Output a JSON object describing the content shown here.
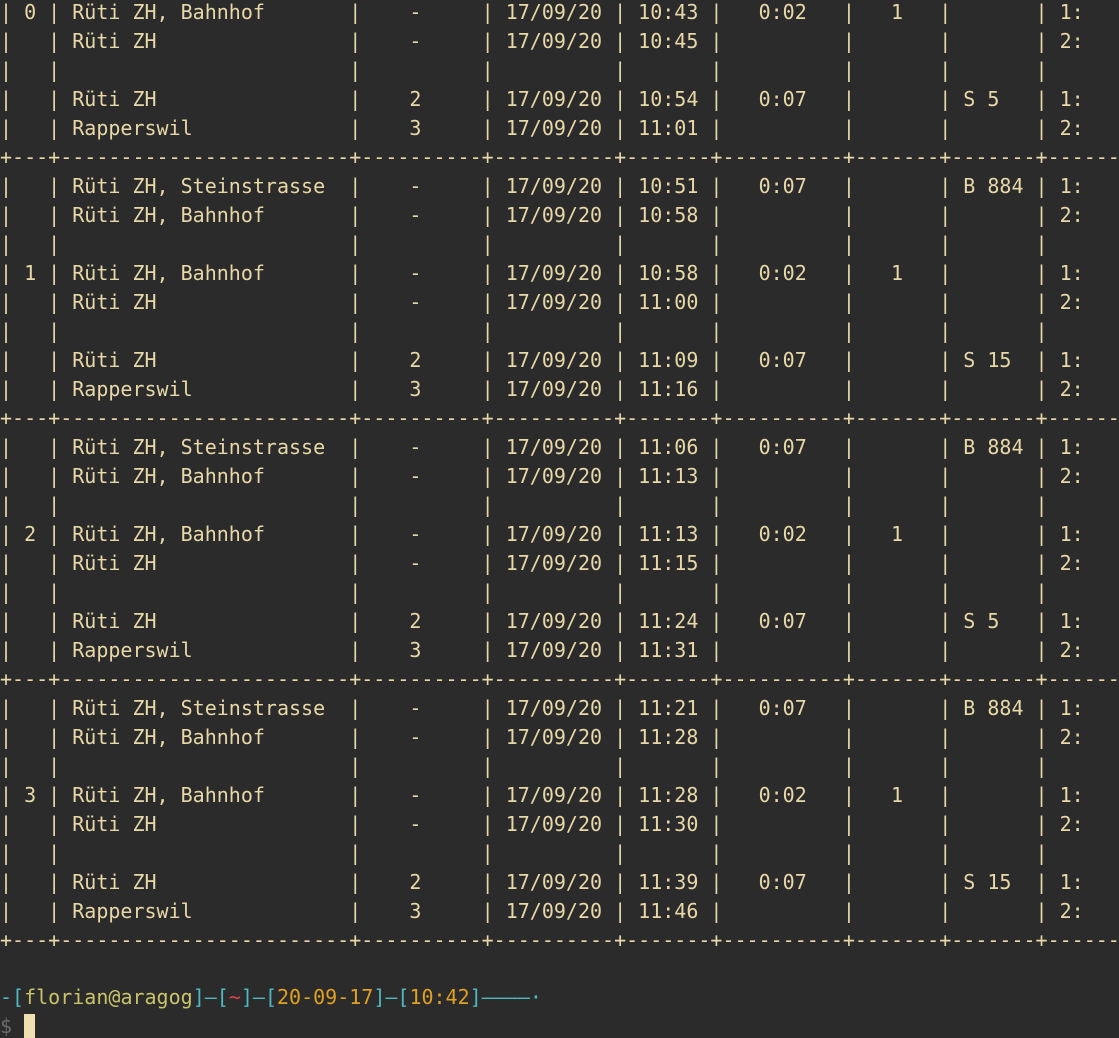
{
  "terminal": {
    "table_lines": [
      "| 0 | Rüti ZH, Bahnhof       |    -     | 17/09/20 | 10:43 |   0:02   |   1   |       | 1:         |",
      "|   | Rüti ZH                |    -     | 17/09/20 | 10:45 |          |       |       | 2:         |",
      "|   |                        |          |          |       |          |       |       |            |",
      "|   | Rüti ZH                |    2     | 17/09/20 | 10:54 |   0:07   |       | S 5   | 1:         |",
      "|   | Rapperswil             |    3     | 17/09/20 | 11:01 |          |       |       | 2:         |",
      "+---+------------------------+----------+----------+-------+----------+-------+-------+------------+",
      "|   | Rüti ZH, Steinstrasse  |    -     | 17/09/20 | 10:51 |   0:07   |       | B 884 | 1:         |",
      "|   | Rüti ZH, Bahnhof       |    -     | 17/09/20 | 10:58 |          |       |       | 2:         |",
      "|   |                        |          |          |       |          |       |       |            |",
      "| 1 | Rüti ZH, Bahnhof       |    -     | 17/09/20 | 10:58 |   0:02   |   1   |       | 1:         |",
      "|   | Rüti ZH                |    -     | 17/09/20 | 11:00 |          |       |       | 2:         |",
      "|   |                        |          |          |       |          |       |       |            |",
      "|   | Rüti ZH                |    2     | 17/09/20 | 11:09 |   0:07   |       | S 15  | 1:         |",
      "|   | Rapperswil             |    3     | 17/09/20 | 11:16 |          |       |       | 2:         |",
      "+---+------------------------+----------+----------+-------+----------+-------+-------+------------+",
      "|   | Rüti ZH, Steinstrasse  |    -     | 17/09/20 | 11:06 |   0:07   |       | B 884 | 1:         |",
      "|   | Rüti ZH, Bahnhof       |    -     | 17/09/20 | 11:13 |          |       |       | 2:         |",
      "|   |                        |          |          |       |          |       |       |            |",
      "| 2 | Rüti ZH, Bahnhof       |    -     | 17/09/20 | 11:13 |   0:02   |   1   |       | 1:         |",
      "|   | Rüti ZH                |    -     | 17/09/20 | 11:15 |          |       |       | 2:         |",
      "|   |                        |          |          |       |          |       |       |            |",
      "|   | Rüti ZH                |    2     | 17/09/20 | 11:24 |   0:07   |       | S 5   | 1:         |",
      "|   | Rapperswil             |    3     | 17/09/20 | 11:31 |          |       |       | 2:         |",
      "+---+------------------------+----------+----------+-------+----------+-------+-------+------------+",
      "|   | Rüti ZH, Steinstrasse  |    -     | 17/09/20 | 11:21 |   0:07   |       | B 884 | 1:         |",
      "|   | Rüti ZH, Bahnhof       |    -     | 17/09/20 | 11:28 |          |       |       | 2:         |",
      "|   |                        |          |          |       |          |       |       |            |",
      "| 3 | Rüti ZH, Bahnhof       |    -     | 17/09/20 | 11:28 |   0:02   |   1   |       | 1:         |",
      "|   | Rüti ZH                |    -     | 17/09/20 | 11:30 |          |       |       | 2:         |",
      "|   |                        |          |          |       |          |       |       |            |",
      "|   | Rüti ZH                |    2     | 17/09/20 | 11:39 |   0:07   |       | S 15  | 1:         |",
      "|   | Rapperswil             |    3     | 17/09/20 | 11:46 |          |       |       | 2:         |",
      "+---+------------------------+----------+----------+-------+----------+-------+-------+------------+",
      ""
    ],
    "prompt": {
      "frame_open": "-[",
      "user": "florian",
      "at": "@",
      "host": "aragog",
      "sep1": "]—[",
      "cwd": "~",
      "sep2": "]—[",
      "date": "20-09-17",
      "sep3": "]—[",
      "time": "10:42",
      "frame_close": "]————·",
      "symbol": "$ "
    },
    "colors": {
      "background": "#2b2b2b",
      "text": "#e8d8a8",
      "frame": "#4fb8c0",
      "user": "#c9c36a",
      "cwd": "#e04040",
      "value": "#e0a020"
    }
  }
}
